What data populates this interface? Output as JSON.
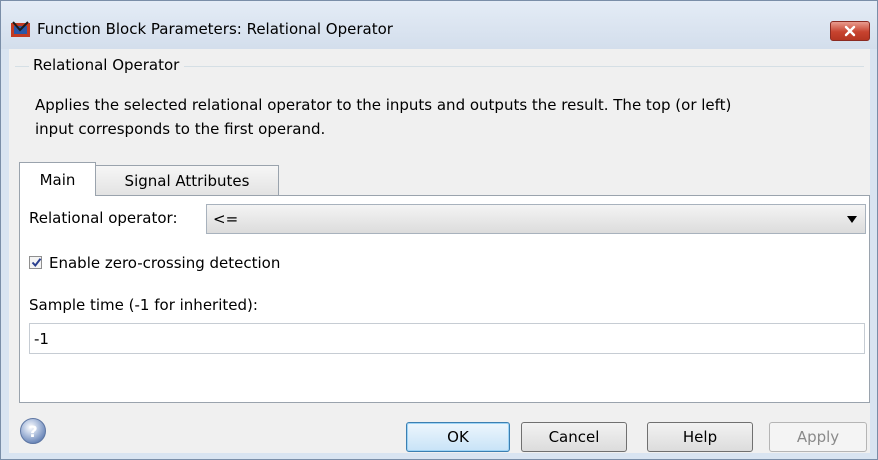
{
  "window": {
    "title": "Function Block Parameters: Relational Operator"
  },
  "group": {
    "label": "Relational Operator",
    "description_line1": "Applies the selected relational operator to the inputs and outputs the result. The top (or left)",
    "description_line2": "input corresponds to the first operand."
  },
  "tabs": [
    {
      "label": "Main",
      "active": true
    },
    {
      "label": "Signal Attributes",
      "active": false
    }
  ],
  "main": {
    "relational_operator_label": "Relational operator:",
    "relational_operator_value": "<=",
    "zero_crossing_label": "Enable zero-crossing detection",
    "zero_crossing_checked": true,
    "sample_time_label": "Sample time (-1 for inherited):",
    "sample_time_value": "-1"
  },
  "buttons": {
    "ok": "OK",
    "cancel": "Cancel",
    "help": "Help",
    "apply": "Apply"
  },
  "icons": {
    "app": "simulink-block-icon",
    "close": "close-icon",
    "help": "question-mark-icon"
  },
  "colors": {
    "titlebar": "#d9e4f1",
    "close_button": "#c7432f",
    "default_button_border": "#3c7fb1"
  }
}
